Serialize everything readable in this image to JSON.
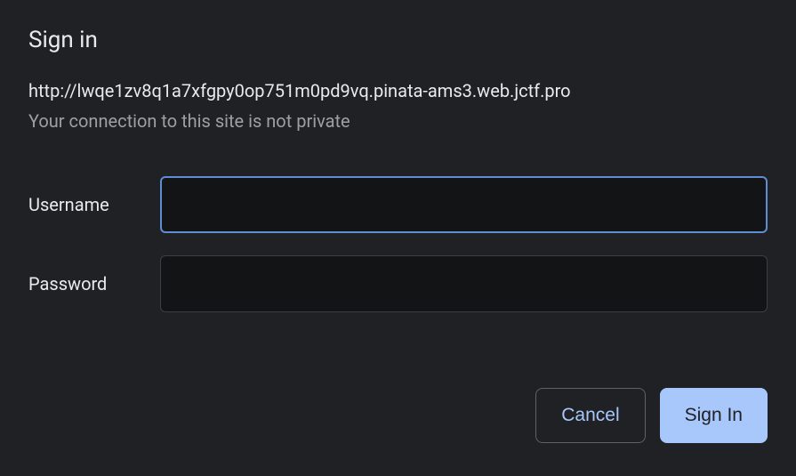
{
  "dialog": {
    "title": "Sign in",
    "url": "http://lwqe1zv8q1a7xfgpy0op751m0pd9vq.pinata-ams3.web.jctf.pro",
    "warning": "Your connection to this site is not private",
    "fields": {
      "username": {
        "label": "Username",
        "value": ""
      },
      "password": {
        "label": "Password",
        "value": ""
      }
    },
    "buttons": {
      "cancel": "Cancel",
      "signin": "Sign In"
    }
  }
}
